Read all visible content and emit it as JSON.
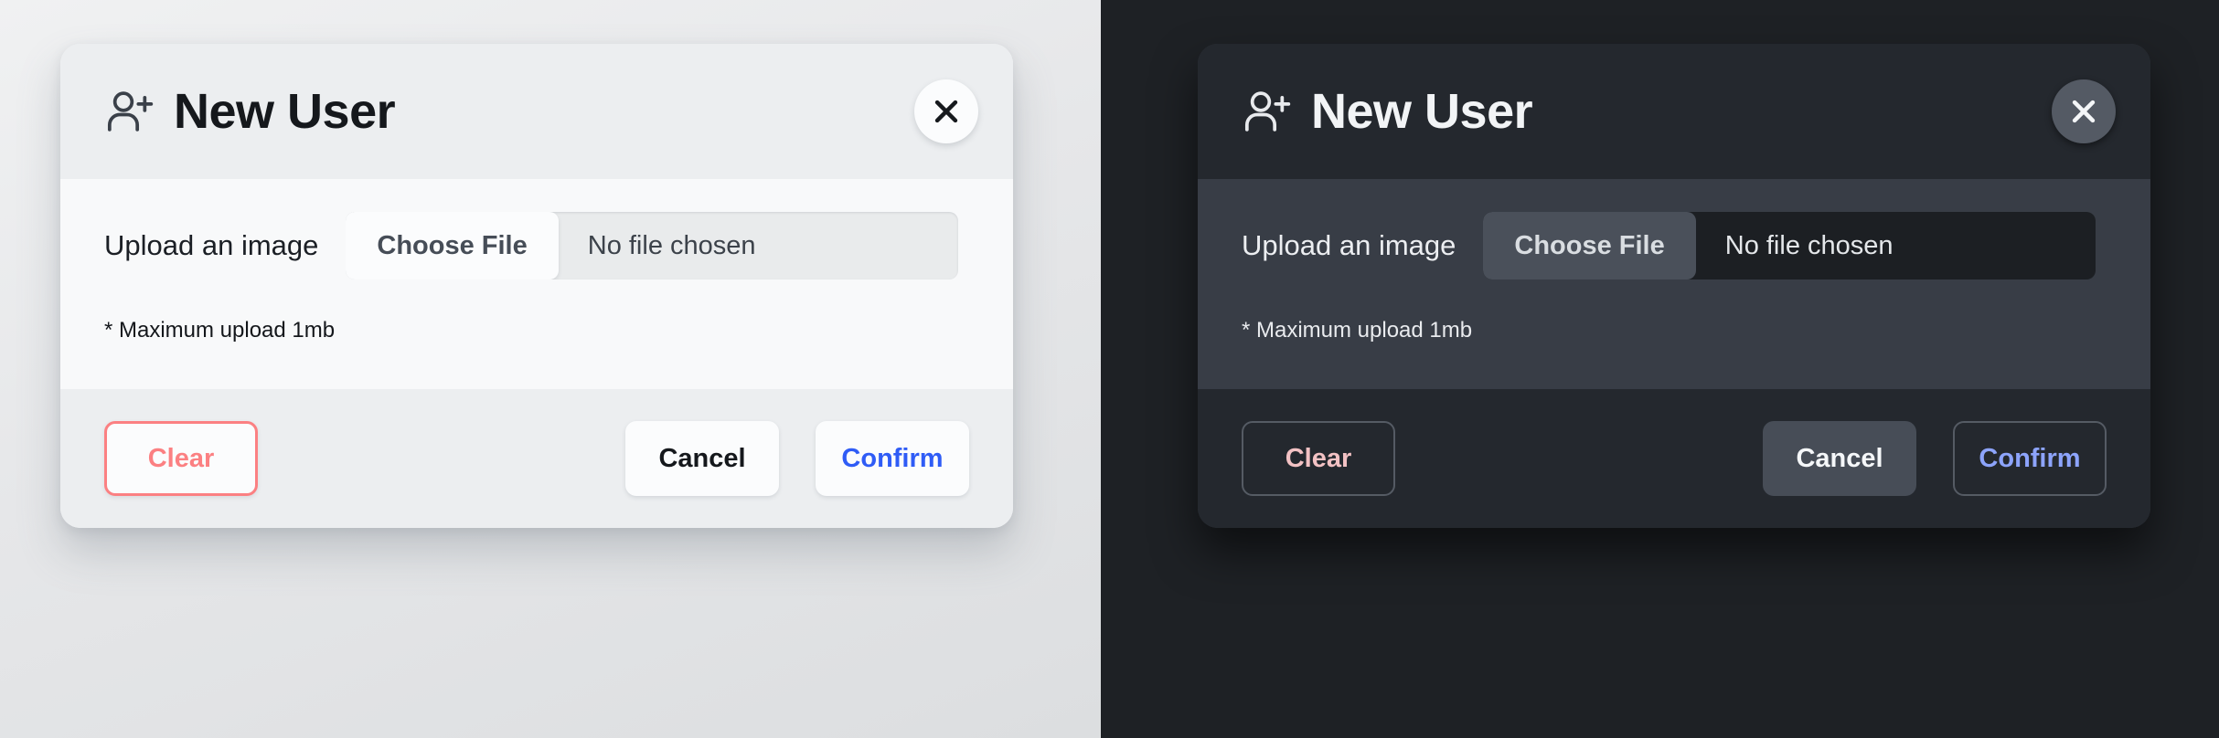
{
  "layout": {
    "panels": [
      {
        "theme": "light",
        "name": "light-theme-panel"
      },
      {
        "theme": "dark",
        "name": "dark-theme-panel"
      }
    ]
  },
  "dialog": {
    "title": "New User",
    "title_icon": "user-plus-icon",
    "close_icon": "close-icon",
    "upload": {
      "label": "Upload an image",
      "choose_file_label": "Choose File",
      "file_status": "No file chosen",
      "hint": "* Maximum upload 1mb"
    },
    "actions": {
      "clear_label": "Clear",
      "cancel_label": "Cancel",
      "confirm_label": "Confirm"
    }
  },
  "colors": {
    "light_bg": "#e6e7e9",
    "dark_bg": "#1e2125",
    "light_card_header": "#eceef0",
    "light_card_body": "#f8f9fa",
    "dark_card_header": "#24282e",
    "dark_card_body": "#383d46",
    "clear_light": "#fb8082",
    "clear_dark": "#f3c2c4",
    "confirm_light": "#2f5cf6",
    "confirm_dark": "#8da4fc",
    "choose_file_dark_bg": "#4a505a"
  }
}
